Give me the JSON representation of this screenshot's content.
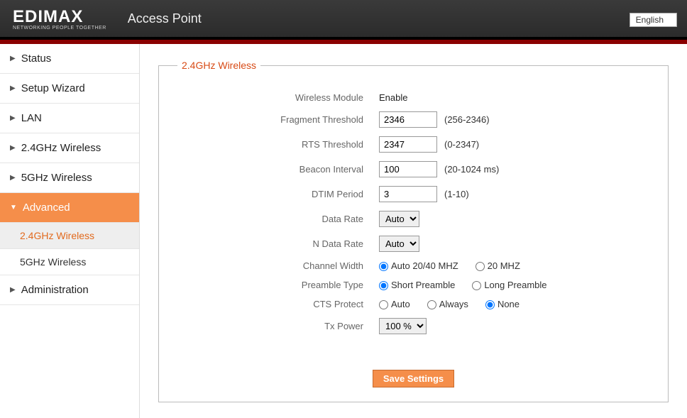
{
  "header": {
    "brand": "EDIMAX",
    "brand_sub": "NETWORKING PEOPLE TOGETHER",
    "title": "Access Point",
    "language": "English"
  },
  "sidebar": {
    "items": [
      {
        "label": "Status"
      },
      {
        "label": "Setup Wizard"
      },
      {
        "label": "LAN"
      },
      {
        "label": "2.4GHz Wireless"
      },
      {
        "label": "5GHz Wireless"
      },
      {
        "label": "Advanced",
        "active": true
      },
      {
        "label": "Administration"
      }
    ],
    "advanced_sub": [
      {
        "label": "2.4GHz Wireless",
        "selected": true
      },
      {
        "label": "5GHz Wireless"
      }
    ]
  },
  "panel": {
    "legend": "2.4GHz Wireless",
    "labels": {
      "wireless_module": "Wireless Module",
      "fragment_threshold": "Fragment Threshold",
      "rts_threshold": "RTS Threshold",
      "beacon_interval": "Beacon Interval",
      "dtim_period": "DTIM Period",
      "data_rate": "Data Rate",
      "n_data_rate": "N Data Rate",
      "channel_width": "Channel Width",
      "preamble_type": "Preamble Type",
      "cts_protect": "CTS Protect",
      "tx_power": "Tx Power"
    },
    "values": {
      "wireless_module": "Enable",
      "fragment_threshold": "2346",
      "rts_threshold": "2347",
      "beacon_interval": "100",
      "dtim_period": "3",
      "data_rate": "Auto",
      "n_data_rate": "Auto",
      "tx_power": "100 %"
    },
    "hints": {
      "fragment_threshold": "(256-2346)",
      "rts_threshold": "(0-2347)",
      "beacon_interval": "(20-1024 ms)",
      "dtim_period": "(1-10)"
    },
    "radios": {
      "channel_width": {
        "opt1": "Auto 20/40 MHZ",
        "opt2": "20 MHZ"
      },
      "preamble_type": {
        "opt1": "Short Preamble",
        "opt2": "Long Preamble"
      },
      "cts_protect": {
        "opt1": "Auto",
        "opt2": "Always",
        "opt3": "None"
      }
    },
    "save_button": "Save Settings"
  }
}
